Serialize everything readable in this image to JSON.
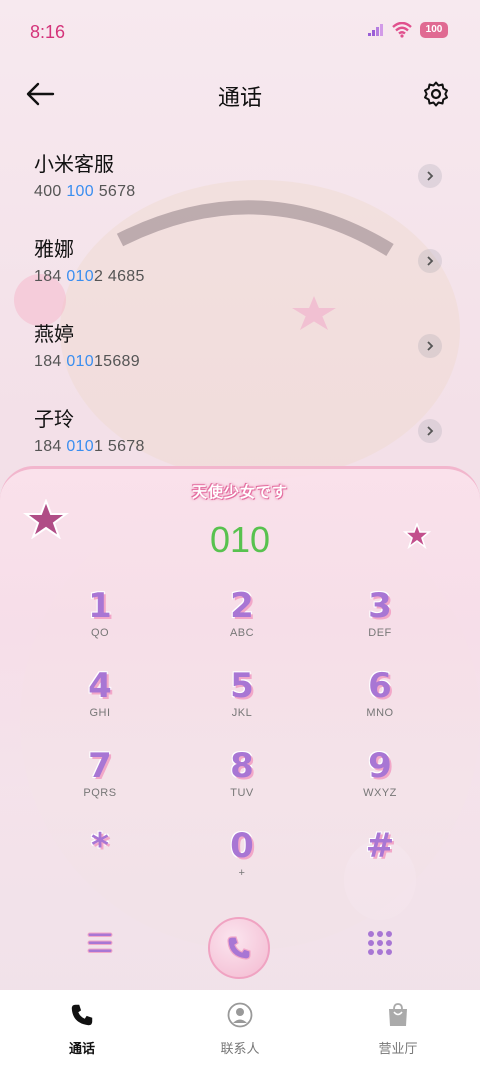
{
  "status_bar": {
    "time": "8:16",
    "battery": "100"
  },
  "header": {
    "title": "通话"
  },
  "contacts": [
    {
      "name": "小米客服",
      "number_pre": "400 ",
      "number_hl": "100",
      "number_post": " 5678"
    },
    {
      "name": "雅娜",
      "number_pre": "184 ",
      "number_hl": "010",
      "number_post": "2 4685"
    },
    {
      "name": "燕婷",
      "number_pre": "184 ",
      "number_hl": "010",
      "number_post": "15689"
    },
    {
      "name": "子玲",
      "number_pre": "184 ",
      "number_hl": "010",
      "number_post": "1 5678"
    }
  ],
  "dialer": {
    "banner": "天使少女です",
    "input": "010",
    "keys": [
      {
        "digit": "1",
        "letters": "QO"
      },
      {
        "digit": "2",
        "letters": "ABC"
      },
      {
        "digit": "3",
        "letters": "DEF"
      },
      {
        "digit": "4",
        "letters": "GHI"
      },
      {
        "digit": "5",
        "letters": "JKL"
      },
      {
        "digit": "6",
        "letters": "MNO"
      },
      {
        "digit": "7",
        "letters": "PQRS"
      },
      {
        "digit": "8",
        "letters": "TUV"
      },
      {
        "digit": "9",
        "letters": "WXYZ"
      },
      {
        "digit": "*",
        "letters": ""
      },
      {
        "digit": "0",
        "letters": "+"
      },
      {
        "digit": "#",
        "letters": ""
      }
    ]
  },
  "tabs": [
    {
      "label": "通话",
      "icon": "phone-icon",
      "active": true
    },
    {
      "label": "联系人",
      "icon": "contact-icon",
      "active": false
    },
    {
      "label": "营业厅",
      "icon": "bag-icon",
      "active": false
    }
  ],
  "colors": {
    "accent_pink": "#e06a92",
    "highlight_blue": "#3a8ef0",
    "dial_green": "#58c24f",
    "key_purple": "#a876d4"
  }
}
